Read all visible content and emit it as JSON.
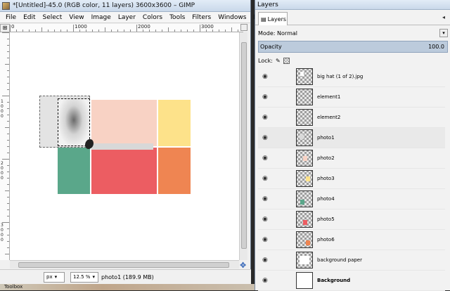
{
  "main_window": {
    "title": "*[Untitled]-45.0 (RGB color, 11 layers) 3600x3600 – GIMP",
    "menu": [
      "File",
      "Edit",
      "Select",
      "View",
      "Image",
      "Layer",
      "Colors",
      "Tools",
      "Filters",
      "Windows",
      "Help"
    ]
  },
  "ruler": {
    "h_labels": [
      "0",
      "1000",
      "2000",
      "3000"
    ],
    "v_labels": [
      "1",
      "0",
      "0",
      "0",
      "2",
      "0",
      "0",
      "0",
      "3",
      "0",
      "0",
      "0"
    ]
  },
  "statusbar": {
    "unit": "px",
    "zoom": "12.5 %",
    "message": "photo1 (189.9 MB)"
  },
  "layers_dock": {
    "title": "Layers",
    "tab_label": "Layers",
    "mode_label": "Mode: Normal",
    "opacity_label": "Opacity",
    "opacity_value": "100.0",
    "lock_label": "Lock:",
    "layers": [
      {
        "name": "big hat (1 of 2).jpg",
        "active": false
      },
      {
        "name": "element1",
        "active": false
      },
      {
        "name": "element2",
        "active": false
      },
      {
        "name": "photo1",
        "active": true
      },
      {
        "name": "photo2",
        "active": false
      },
      {
        "name": "photo3",
        "active": false
      },
      {
        "name": "photo4",
        "active": false
      },
      {
        "name": "photo5",
        "active": false
      },
      {
        "name": "photo6",
        "active": false
      },
      {
        "name": "background paper",
        "active": false
      },
      {
        "name": "Background",
        "active": false
      }
    ]
  },
  "toolbox_label": "Toolbox",
  "colors": {
    "peach": "#f8d2c4",
    "yellow": "#fde28a",
    "teal": "#5aa78a",
    "coral": "#ec5d62",
    "orange": "#ef8552",
    "selection_gray": "#e3e3e3"
  }
}
